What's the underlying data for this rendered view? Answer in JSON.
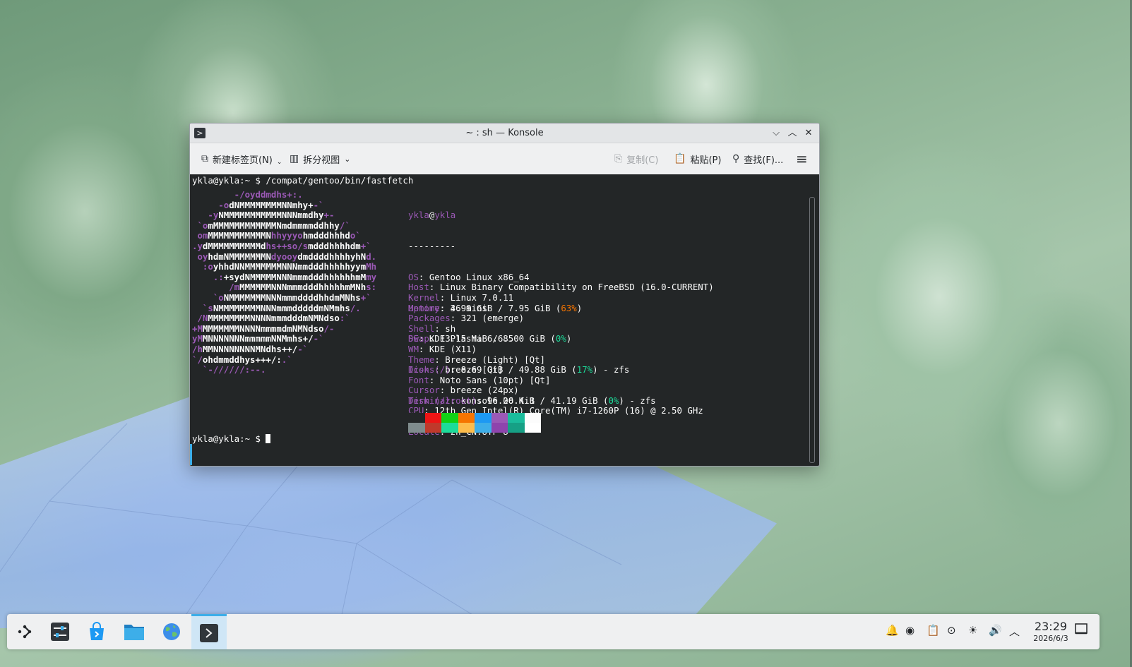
{
  "window": {
    "title": "~ : sh — Konsole",
    "app_icon": ">",
    "buttons": {
      "minimize": "⌵",
      "maximize": "︿",
      "close": "✕"
    }
  },
  "toolbar": {
    "new_tab": "新建标签页(N)",
    "split_view": "拆分视图",
    "copy": "复制(C)",
    "paste": "粘贴(P)",
    "find": "查找(F)...",
    "menu_icon": "≡"
  },
  "terminal": {
    "command_line": "ykla@ykla:~ $ /compat/gentoo/bin/fastfetch",
    "prompt": "ykla@ykla:~ $ ",
    "user_host": {
      "user": "ykla",
      "at": "@",
      "host": "ykla"
    },
    "separator": "---------",
    "logo": [
      {
        "m1": "        -/oyddmdhs+:.",
        "w": "",
        "m2": ""
      },
      {
        "m1": "     -o",
        "w": "dNMMMMMMMMNNmhy+",
        "m2": "-`"
      },
      {
        "m1": "   -y",
        "w": "NMMMMMMMMMMMNNNmmdhy",
        "m2": "+-"
      },
      {
        "m1": " `o",
        "w": "mMMMMMMMMMMMMNmdmmmmddhhy",
        "m2": "/`"
      },
      {
        "m1": " om",
        "w": "MMMMMMMMMMMN",
        "m2": "hhyyyo",
        "w2": "hmdddhhhd",
        "m3": "o`"
      },
      {
        "m1": ".y",
        "w": "dMMMMMMMMMMd",
        "m2": "hs++so/s",
        "w2": "mdddhhhhdm",
        "m3": "+`"
      },
      {
        "m1": " oy",
        "w": "hdmNMMMMMMMN",
        "m2": "dyooy",
        "w2": "dmddddhhhhyhN",
        "m3": "d."
      },
      {
        "m1": "  :o",
        "w": "yhhdNNMMMMMMMNNNmmdddhhhhhyym",
        "m2": "Mh"
      },
      {
        "m1": "    .:",
        "w": "+sydNMMMMMNNNmmmdddhhhhhhmM",
        "m2": "my"
      },
      {
        "m1": "       /m",
        "w": "MMMMMMNNNmmmdddhhhhhmMNh",
        "m2": "s:"
      },
      {
        "m1": "    `o",
        "w": "NMMMMMMMNNNmmmddddhhdmMNhs",
        "m2": "+`"
      },
      {
        "m1": "  `s",
        "w": "NMMMMMMMMNNNmmmdddddmNMmhs",
        "m2": "/."
      },
      {
        "m1": " /N",
        "w": "MMMMMMMMNNNNmmmdddmNMNdso",
        "m2": ":`"
      },
      {
        "m1": "+M",
        "w": "MMMMMMMNNNNmmmmdmNMNdso",
        "m2": "/-"
      },
      {
        "m1": "yM",
        "w": "MNNNNNNNmmmmmNNMmhs+/",
        "m2": "-`"
      },
      {
        "m1": "/h",
        "w": "MMNNNNNNNNMNdhs++/",
        "m2": "-`"
      },
      {
        "m1": "`/",
        "w": "ohdmmddhys+++/:",
        "m2": ".`"
      },
      {
        "m1": "  `-//////:--.",
        "w": "",
        "m2": ""
      }
    ],
    "info": [
      {
        "key": "OS",
        "value": ": Gentoo Linux x86_64"
      },
      {
        "key": "Host",
        "value": ": Linux Binary Compatibility on FreeBSD (16.0-CURRENT)"
      },
      {
        "key": "Kernel",
        "value": ": Linux 7.0.11"
      },
      {
        "key": "Uptime",
        "value": ": 36 mins"
      },
      {
        "key": "Packages",
        "value": ": 321 (emerge)"
      },
      {
        "key": "Shell",
        "value": ": sh"
      },
      {
        "key": "DE",
        "value": ": KDE Plasma 6.6.5"
      },
      {
        "key": "WM",
        "value": ": KDE (X11)"
      },
      {
        "key": "Theme",
        "value": ": Breeze (Light) [Qt]"
      },
      {
        "key": "Icons",
        "value": ": breeze [Qt]"
      },
      {
        "key": "Font",
        "value": ": Noto Sans (10pt) [Qt]"
      },
      {
        "key": "Cursor",
        "value": ": breeze (24px)"
      },
      {
        "key": "Terminal",
        "value": ": konsole 26.4.1"
      },
      {
        "key": "CPU",
        "value": ": 12th Gen Intel(R) Core(TM) i7-1260P (16) @ 2.50 GHz"
      }
    ],
    "memory": {
      "key": "Memory",
      "pre": ": 4.99 GiB / 7.95 GiB (",
      "pct": "63%",
      "post": ")"
    },
    "swap": {
      "key": "Swap",
      "pre": ": 13.15 MiB / 8.00 GiB (",
      "pct": "0%",
      "post": ")"
    },
    "disk_root": {
      "key": "Disk (/)",
      "pre": ": 8.69 GiB / 49.88 GiB (",
      "pct": "17%",
      "post": ") - zfs"
    },
    "disk_zroot": {
      "key": "Disk (/zroot)",
      "pre": ": 96.00 KiB / 41.19 GiB (",
      "pct": "0%",
      "post": ") - zfs"
    },
    "locale": {
      "key": "Locale",
      "value": ": zh_CN.UTF-8"
    },
    "palette_top": [
      "#232627",
      "#ed1515",
      "#11d116",
      "#f67400",
      "#1d99f3",
      "#9b59b6",
      "#1abc9c",
      "#fcfcfc"
    ],
    "palette_bottom": [
      "#7f8c8d",
      "#c0392b",
      "#1cdc9a",
      "#fdbc4b",
      "#3daee9",
      "#8e44ad",
      "#16a085",
      "#ffffff"
    ]
  },
  "taskbar": {
    "items": [
      {
        "name": "app-launcher",
        "icon": "launcher-icon"
      },
      {
        "name": "system-settings",
        "icon": "settings-icon"
      },
      {
        "name": "discover",
        "icon": "store-icon"
      },
      {
        "name": "dolphin",
        "icon": "folder-icon"
      },
      {
        "name": "web-browser",
        "icon": "globe-icon"
      },
      {
        "name": "konsole",
        "icon": "terminal-icon",
        "active": true
      }
    ],
    "tray_icons": [
      "notifications-icon",
      "network-icon",
      "clipboard-icon",
      "media-icon",
      "brightness-icon",
      "volume-icon",
      "expand-icon"
    ],
    "clock": {
      "time": "23:29",
      "date": "2026/6/3"
    },
    "show_desktop_icon": "show-desktop-icon"
  }
}
